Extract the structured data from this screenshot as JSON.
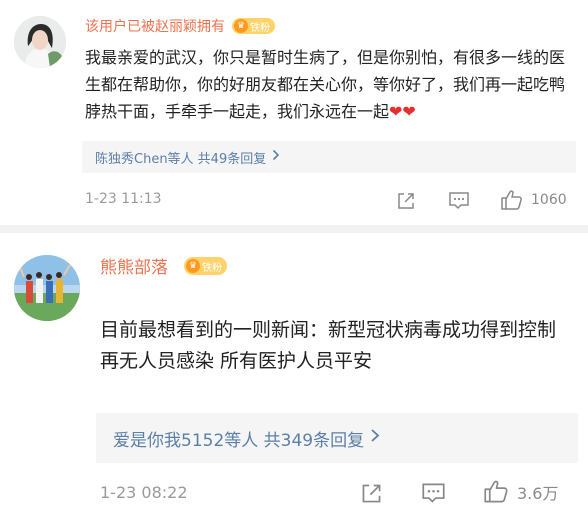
{
  "comments": [
    {
      "username": "该用户已被赵丽颖拥有",
      "badge": "铁粉",
      "text": "我最亲爱的武汉，你只是暂时生病了，但是你别怕，有很多一线的医生都在帮助你，你的好朋友都在关心你，等你好了，我们再一起吃鸭脖热干面，手牵手一起走，我们永远在一起",
      "hearts": "❤❤",
      "replies": "陈独秀Chen等人  共49条回复",
      "time": "1-23 11:13",
      "likes": "1060"
    },
    {
      "username": "熊熊部落",
      "badge": "铁粉",
      "text": "目前最想看到的一则新闻：新型冠状病毒成功得到控制 再无人员感染 所有医护人员平安",
      "replies": "爱是你我5152等人  共349条回复",
      "time": "1-23 08:22",
      "likes": "3.6万"
    }
  ],
  "icons": {
    "share": "share-icon",
    "comment": "comment-icon",
    "like": "thumbs-up-icon",
    "crown": "crown-icon",
    "chevron": "chevron-right-icon"
  },
  "colors": {
    "username": "#eb7350",
    "reply_link": "#5b7fa8",
    "badge": "#ffd36a",
    "heart": "#e52e2e"
  }
}
